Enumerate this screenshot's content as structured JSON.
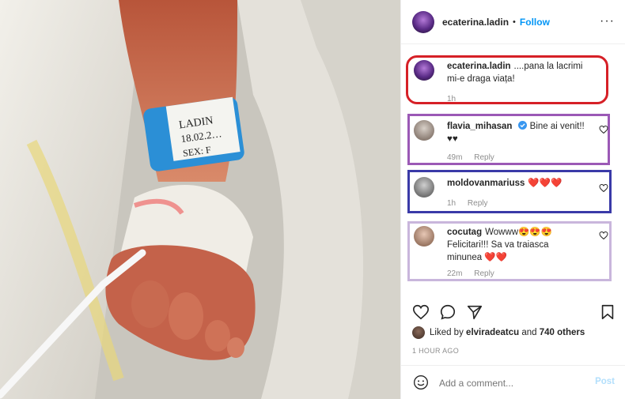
{
  "post": {
    "username": "ecaterina.ladin",
    "separator": "•",
    "follow_label": "Follow",
    "more_label": "···",
    "photo_alt": "Baby foot with hospital wristband"
  },
  "comments": [
    {
      "user": "ecaterina.ladin",
      "text": "....pana la lacrimi mi-e draga viața!",
      "time": "1h",
      "reply": "",
      "highlight": "#d62027"
    },
    {
      "user": "flavia_mihasan",
      "verified": true,
      "text": "Bine ai venit!! ♥♥",
      "time": "49m",
      "reply": "Reply",
      "highlight": "#9b59b6"
    },
    {
      "user": "moldovanmariuss",
      "text": "❤️❤️❤️",
      "time": "1h",
      "reply": "Reply",
      "highlight": "#3a3aa8"
    },
    {
      "user": "cocutag",
      "text": "Wowww😍😍😍 Felicitari!!! Sa va traiasca minunea ❤️❤️",
      "time": "22m",
      "reply": "Reply",
      "highlight": "#c9b6dc"
    }
  ],
  "likes": {
    "prefix": "Liked by",
    "user": "elviradeatcu",
    "and": "and",
    "others": "740 others"
  },
  "timestamp": "1 HOUR AGO",
  "add_comment": {
    "placeholder": "Add a comment...",
    "post_label": "Post"
  },
  "icons": [
    "heart-icon",
    "comment-icon",
    "share-icon",
    "bookmark-icon",
    "emoji-icon",
    "more-icon",
    "verified-icon"
  ],
  "colors": {
    "follow": "#0095f6",
    "post_disabled": "#b2dffc",
    "meta": "#8e8e8e"
  }
}
